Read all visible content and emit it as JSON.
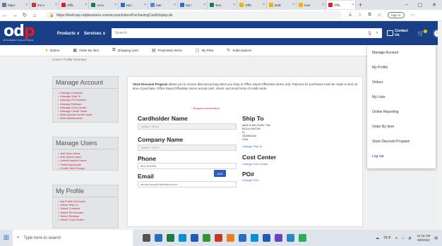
{
  "browser": {
    "tabs": [
      {
        "label": "https:",
        "color": "#6b7a99"
      },
      {
        "label": "the s",
        "color": "#c0392b"
      },
      {
        "label": "Offic",
        "color": "#e31b23"
      },
      {
        "label": "Acco",
        "color": "#1f7a4a"
      },
      {
        "label": "My I",
        "color": "#2a6ec1"
      },
      {
        "label": "Mar",
        "color": "#5b8ad8"
      },
      {
        "label": "My I",
        "color": "#2a6ec1"
      },
      {
        "label": "Tem",
        "color": "#1f7a4a"
      },
      {
        "label": "Offic",
        "color": "#f0b400"
      },
      {
        "label": "Bulk",
        "color": "#f0b400"
      },
      {
        "label": "Harr",
        "color": "#f0b400"
      },
      {
        "label": "Offic",
        "color": "#e31b23"
      }
    ],
    "url": "https://bsd1sqs.odpbusiness.com/account/storePurchasingCardDisplay.do",
    "signin": "Sign in"
  },
  "header": {
    "products": "Products ∨",
    "services": "Services ∨",
    "search_placeholder": "Search",
    "contact": "Contact Us"
  },
  "subnav": [
    {
      "label": "Orders",
      "icon": "orders-icon"
    },
    {
      "label": "Order By Item",
      "icon": "order-by-item-icon"
    },
    {
      "label": "Shopping Lists",
      "icon": "shopping-lists-icon"
    },
    {
      "label": "Proprietary Items",
      "icon": "proprietary-items-icon"
    },
    {
      "label": "My Files",
      "icon": "my-files-icon"
    },
    {
      "label": "Subscriptions",
      "icon": "subscriptions-icon"
    }
  ],
  "dropdown": [
    "Manage Account",
    "My Profile",
    "Orders",
    "My Lists",
    "Online Reporting",
    "Order By Item",
    "Store Discount Program",
    "Log out"
  ],
  "breadcrumb": "Home / Profile Overview",
  "sidebar": {
    "manage_account": {
      "title": "Manage Account",
      "items": [
        "Manage Contacts",
        "Manage Ship To",
        "Manage PO Number",
        "Manage Release",
        "Manage Cost Center",
        "Manage Credit Cards",
        "Bulk Upload Credit Cards",
        "Bulk Maintenance"
      ]
    },
    "manage_users": {
      "title": "Manage Users",
      "items": [
        "Add New Users",
        "Edit Active Users",
        "Active/Inactive Users",
        "Tiered Approvals",
        "Credit Card Groups"
      ]
    },
    "my_profile": {
      "title": "My Profile",
      "items": [
        "My Profile Overview",
        "Select Ship To",
        "Select Contacts",
        "Select PO Number",
        "Select Release",
        "Select Cost Center"
      ]
    }
  },
  "main": {
    "intro_bold": "Store Discount Program",
    "intro_rest": " allows you to receive discount pricing when you shop in Office Depot OfficeMax stores only. Payment for purchases must be made in store at time of purchase. Office Depot OfficeMax stores accept cash, check, and most forms of credit cards.",
    "required": "* Required Information",
    "cardholder_label": "Cardholder Name",
    "cardholder_value": "TAMMY TECH",
    "company_label": "Company Name",
    "company_value": "TAMMY TECH",
    "phone_label": "Phone",
    "phone_value": "5617304908",
    "email_label": "Email",
    "email_value": "tammy.moy@officedepot.com",
    "ship_to_label": "Ship To",
    "ship_to_lines": [
      "6600 N MILITARY TRL",
      "BOCA RATON",
      "FL",
      "334962434",
      "USA"
    ],
    "change_ship_to": "Change Ship To",
    "cost_center_label": "Cost Center",
    "change_cost_center": "Change Cost Center",
    "po_label": "PO#",
    "change_po": "Change PO#",
    "add_button": "ADD"
  },
  "taskbar": {
    "search": "Type here to search",
    "weather": "75°F",
    "time": "11:15 AM",
    "date": "6/9/2022"
  }
}
